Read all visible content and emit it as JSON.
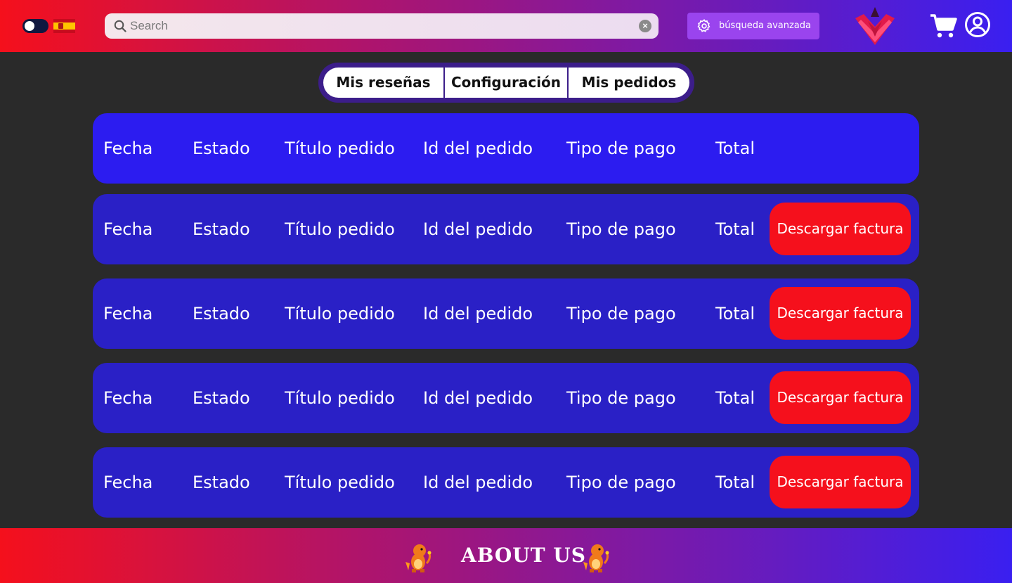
{
  "header": {
    "search": {
      "placeholder": "Search",
      "value": ""
    },
    "advanced_search_label": "búsqueda avanzada",
    "icons": {
      "theme_toggle": "toggle-icon",
      "language": "spain-flag-icon",
      "search": "search-icon",
      "clear": "clear-icon",
      "advanced": "gear-icon",
      "cart": "cart-icon",
      "account": "user-icon",
      "logo": "logo-icon"
    }
  },
  "tabs": [
    {
      "label": "Mis reseñas"
    },
    {
      "label": "Configuración"
    },
    {
      "label": "Mis pedidos"
    }
  ],
  "orders": {
    "columns": [
      "Fecha",
      "Estado",
      "Título pedido",
      "Id del pedido",
      "Tipo de pago",
      "Total"
    ],
    "rows": [
      {
        "cells": [
          "Fecha",
          "Estado",
          "Título pedido",
          "Id del pedido",
          "Tipo de pago",
          "Total"
        ],
        "action": "Descargar factura"
      },
      {
        "cells": [
          "Fecha",
          "Estado",
          "Título pedido",
          "Id del pedido",
          "Tipo de pago",
          "Total"
        ],
        "action": "Descargar factura"
      },
      {
        "cells": [
          "Fecha",
          "Estado",
          "Título pedido",
          "Id del pedido",
          "Tipo de pago",
          "Total"
        ],
        "action": "Descargar factura"
      },
      {
        "cells": [
          "Fecha",
          "Estado",
          "Título pedido",
          "Id del pedido",
          "Tipo de pago",
          "Total"
        ],
        "action": "Descargar factura"
      }
    ]
  },
  "footer": {
    "title": "ABOUT US"
  },
  "colors": {
    "accent_red": "#f5101c",
    "accent_blue": "#2c1cf0",
    "row_blue": "#2a20c6",
    "button_purple": "#9a44ee",
    "background": "#2a2a2a"
  }
}
